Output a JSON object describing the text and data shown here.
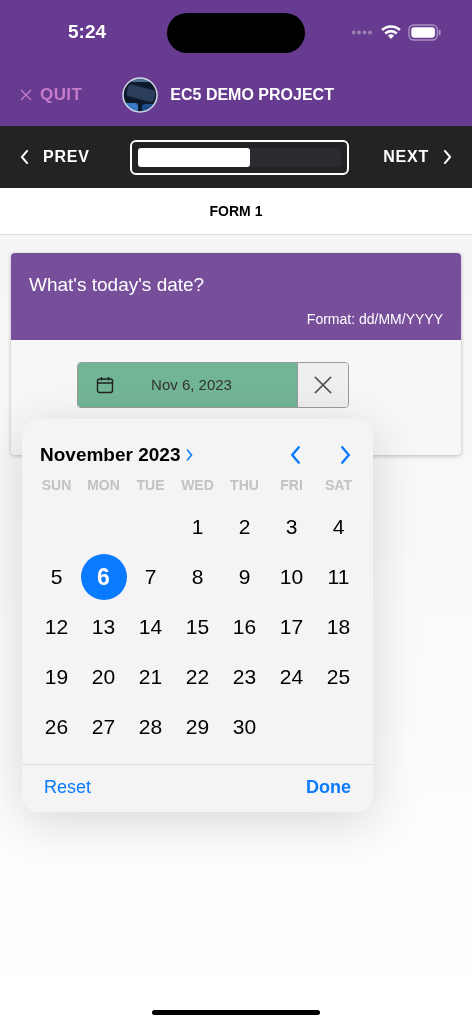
{
  "status_bar": {
    "time": "5:24"
  },
  "header": {
    "quit": "QUIT",
    "project_title": "EC5 DEMO PROJECT"
  },
  "nav": {
    "prev": "PREV",
    "next": "NEXT",
    "progress": {
      "level": 0.55
    }
  },
  "form_title": "FORM 1",
  "question": {
    "title": "What's today's date?",
    "format": "Format: dd/MM/YYYY",
    "value": "Nov 6, 2023"
  },
  "calendar": {
    "month": "November 2023",
    "weekdays": [
      "SUN",
      "MON",
      "TUE",
      "WED",
      "THU",
      "FRI",
      "SAT"
    ],
    "weeks": [
      {
        "days": [
          {
            "label": "1",
            "selected": false
          },
          {
            "label": "2",
            "selected": false
          },
          {
            "label": "3",
            "selected": false
          },
          {
            "label": "4",
            "selected": false
          }
        ]
      },
      {
        "days": [
          {
            "label": "5",
            "selected": false
          },
          {
            "label": "6",
            "selected": true
          },
          {
            "label": "7",
            "selected": false
          },
          {
            "label": "8",
            "selected": false
          },
          {
            "label": "9",
            "selected": false
          },
          {
            "label": "10",
            "selected": false
          },
          {
            "label": "11",
            "selected": false
          }
        ]
      },
      {
        "days": [
          {
            "label": "12",
            "selected": false
          },
          {
            "label": "13",
            "selected": false
          },
          {
            "label": "14",
            "selected": false
          },
          {
            "label": "15",
            "selected": false
          },
          {
            "label": "16",
            "selected": false
          },
          {
            "label": "17",
            "selected": false
          },
          {
            "label": "18",
            "selected": false
          }
        ]
      },
      {
        "days": [
          {
            "label": "19",
            "selected": false
          },
          {
            "label": "20",
            "selected": false
          },
          {
            "label": "21",
            "selected": false
          },
          {
            "label": "22",
            "selected": false
          },
          {
            "label": "23",
            "selected": false
          },
          {
            "label": "24",
            "selected": false
          },
          {
            "label": "25",
            "selected": false
          }
        ]
      },
      {
        "days": [
          {
            "label": "26",
            "selected": false
          },
          {
            "label": "27",
            "selected": false
          },
          {
            "label": "28",
            "selected": false
          },
          {
            "label": "29",
            "selected": false
          },
          {
            "label": "30",
            "selected": false
          }
        ]
      }
    ],
    "reset": "Reset",
    "done": "Done"
  }
}
